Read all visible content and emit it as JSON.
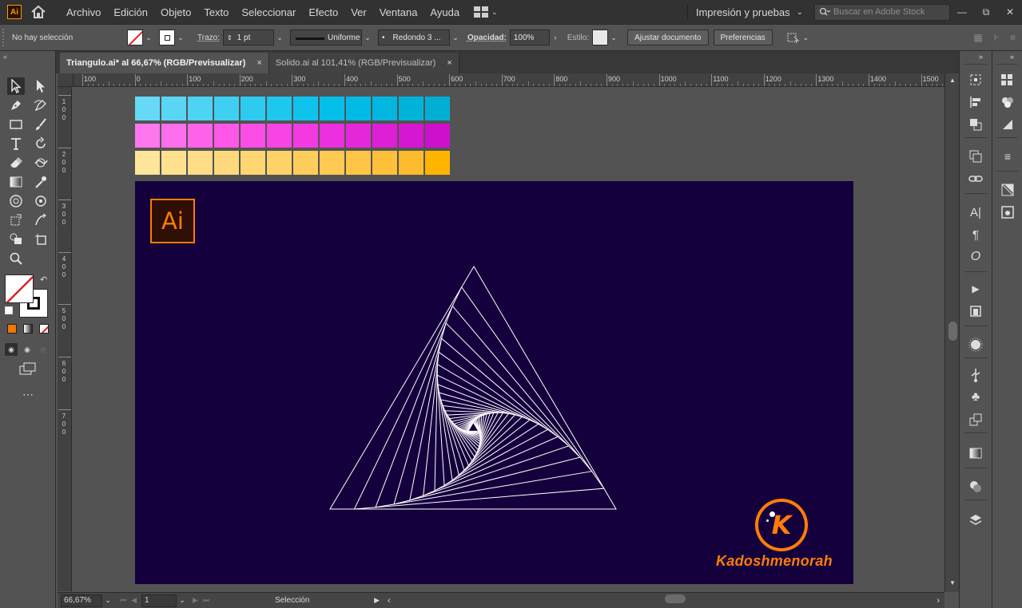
{
  "app": {
    "logo_text": "Ai"
  },
  "menu": {
    "items": [
      "Archivo",
      "Edición",
      "Objeto",
      "Texto",
      "Seleccionar",
      "Efecto",
      "Ver",
      "Ventana",
      "Ayuda"
    ],
    "workspace": "Impresión y pruebas",
    "stock_search_placeholder": "Buscar en Adobe Stock"
  },
  "control_bar": {
    "selection_status": "No hay selección",
    "stroke_label": "Trazo:",
    "stroke_weight": "1 pt",
    "stroke_profile": "Uniforme",
    "brush": "Redondo 3 ...",
    "opacity_label": "Opacidad:",
    "opacity_value": "100%",
    "style_label": "Estilo:",
    "adjust_document_button": "Ajustar documento",
    "preferences_button": "Preferencias"
  },
  "tabs": [
    {
      "label": "Triangulo.ai* al 66,67% (RGB/Previsualizar)",
      "close": "×",
      "active": true
    },
    {
      "label": "Solido.ai al 101,41% (RGB/Previsualizar)",
      "close": "×",
      "active": false
    }
  ],
  "ruler": {
    "top_labels": [
      "100",
      "0",
      "100",
      "200",
      "300",
      "400",
      "500",
      "600",
      "700",
      "800",
      "900",
      "1000",
      "1100",
      "1200",
      "1300",
      "1400",
      "1500"
    ],
    "left_labels": [
      "100",
      "200",
      "300",
      "400",
      "500",
      "600",
      "700"
    ]
  },
  "swatches": {
    "cyan": [
      "#65d9f6",
      "#5ad6f5",
      "#4dd3f4",
      "#3fcff2",
      "#2ecbf0",
      "#1dc7ee",
      "#0fc3ec",
      "#04bfe9",
      "#02bbe4",
      "#01b7df",
      "#00b3d9",
      "#00afd3"
    ],
    "magenta": [
      "#ff77ee",
      "#ff6eec",
      "#ff63ea",
      "#ff58e8",
      "#fc4de6",
      "#f744e4",
      "#f23ae1",
      "#ec30de",
      "#e527da",
      "#dd1fd6",
      "#d517d1",
      "#cd10cc"
    ],
    "yellow": [
      "#ffe59a",
      "#ffe190",
      "#ffdd86",
      "#ffd97c",
      "#ffd672",
      "#ffd268",
      "#ffcd5c",
      "#ffc952",
      "#ffc547",
      "#ffc03c",
      "#ffbb2e",
      "#ffb400"
    ]
  },
  "artboard": {
    "badge_text": "Ai",
    "brand_letter": "K",
    "brand_name": "Kadoshmenorah"
  },
  "status_bar": {
    "zoom": "66,67%",
    "artboard_number": "1",
    "tool_status": "Selección"
  },
  "colors": {
    "artboard_bg": "#14003c",
    "brand_orange": "#ff7d0a",
    "line_color": "#ffffff"
  }
}
